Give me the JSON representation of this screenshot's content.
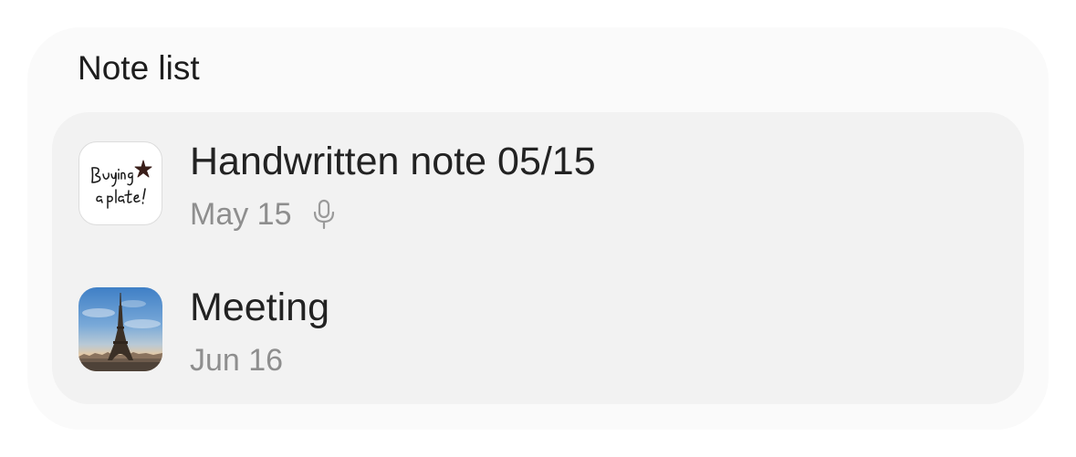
{
  "widget": {
    "title": "Note list"
  },
  "notes": [
    {
      "title": "Handwritten note 05/15",
      "date": "May 15",
      "thumbnail_text": "Buying a plate!",
      "has_voice_recording": true,
      "icon": "microphone-icon"
    },
    {
      "title": "Meeting",
      "date": "Jun 16",
      "thumbnail_subject": "eiffel-tower-photo",
      "has_voice_recording": false
    }
  ],
  "colors": {
    "widget_bg": "#fafafa",
    "panel_bg": "#f2f2f2",
    "title_text": "#222222",
    "meta_text": "#8e8e8e"
  }
}
